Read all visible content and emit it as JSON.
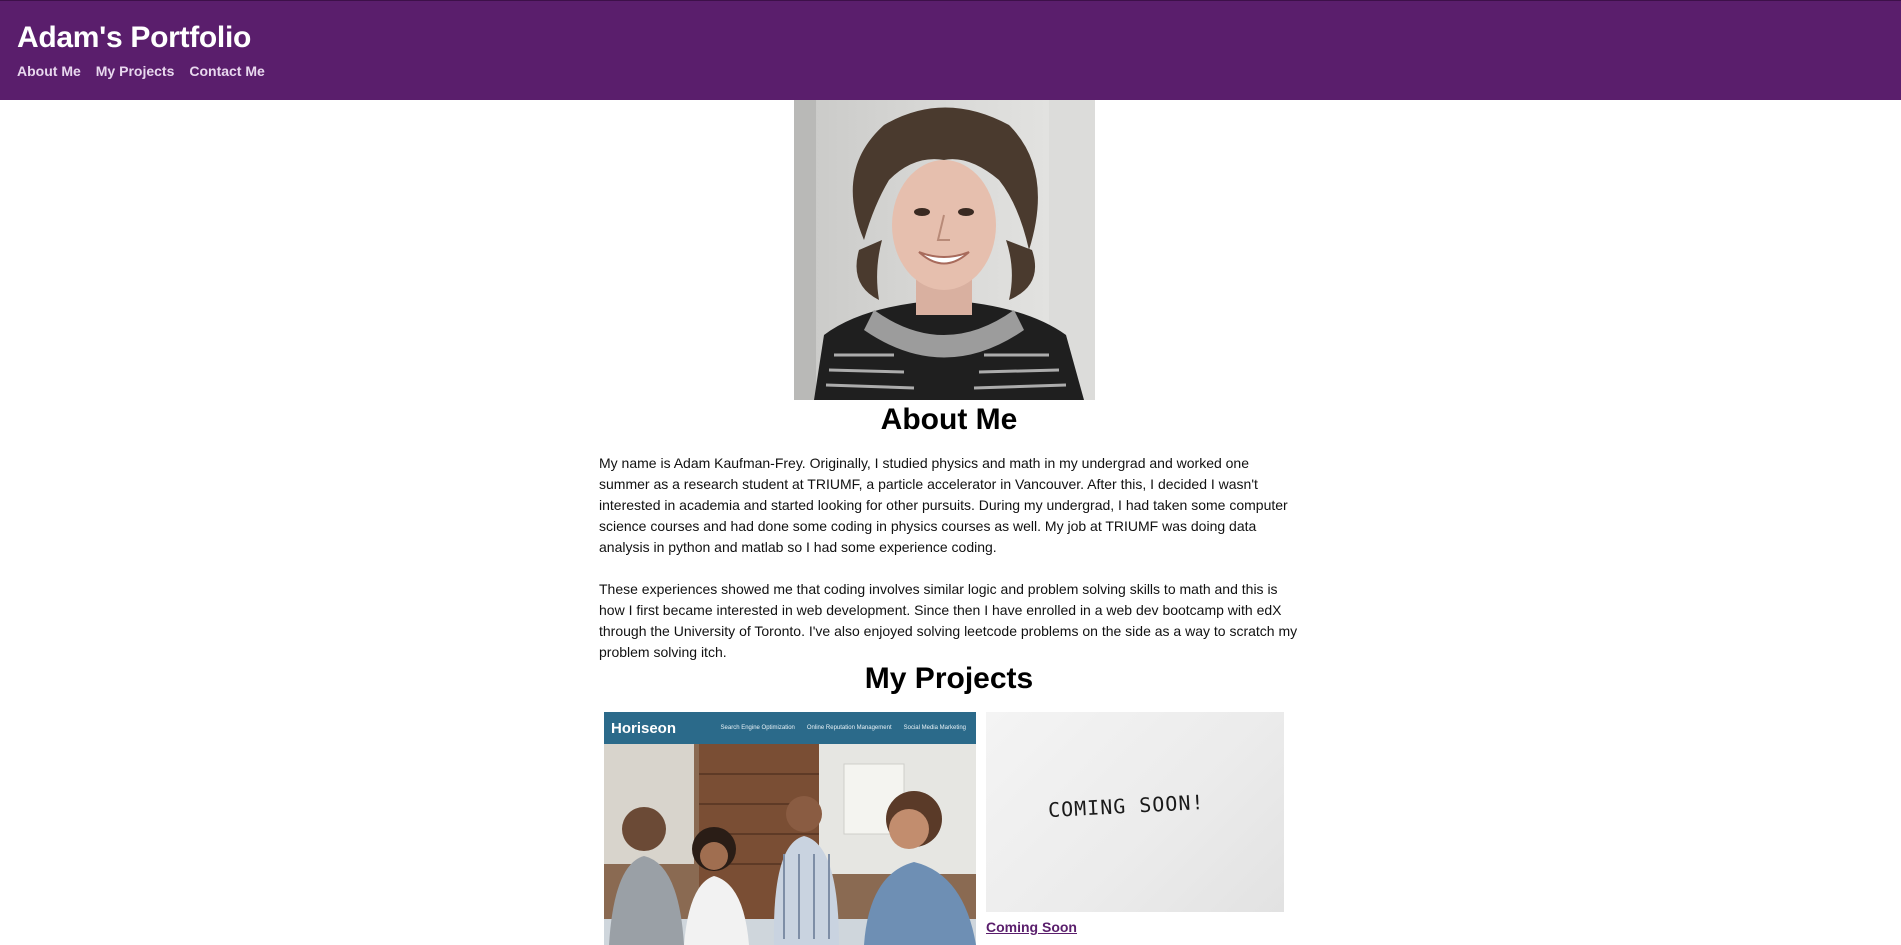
{
  "header": {
    "title": "Adam's Portfolio",
    "nav": [
      {
        "label": "About Me"
      },
      {
        "label": "My Projects"
      },
      {
        "label": "Contact Me"
      }
    ],
    "background_color": "#5a1e6c"
  },
  "about": {
    "heading": "About Me",
    "paragraphs": [
      "My name is Adam Kaufman-Frey. Originally, I studied physics and math in my undergrad and worked one summer as a research student at TRIUMF, a particle accelerator in Vancouver. After this, I decided I wasn't interested in academia and started looking for other pursuits. During my undergrad, I had taken some computer science courses and had done some coding in physics courses as well. My job at TRIUMF was doing data analysis in python and matlab so I had some experience coding.",
      "These experiences showed me that coding involves similar logic and problem solving skills to math and this is how I first became interested in web development. Since then I have enrolled in a web dev bootcamp with edX through the University of Toronto. I've also enjoyed solving leetcode problems on the side as a way to scratch my problem solving itch."
    ]
  },
  "projects": {
    "heading": "My Projects",
    "items": [
      {
        "screenshot_brand": "Horiseon",
        "screenshot_menu": [
          "Search Engine Optimization",
          "Online Reputation Management",
          "Social Media Marketing"
        ]
      },
      {
        "image_text": "COMING SOON!",
        "link_label": "Coming Soon"
      }
    ]
  }
}
